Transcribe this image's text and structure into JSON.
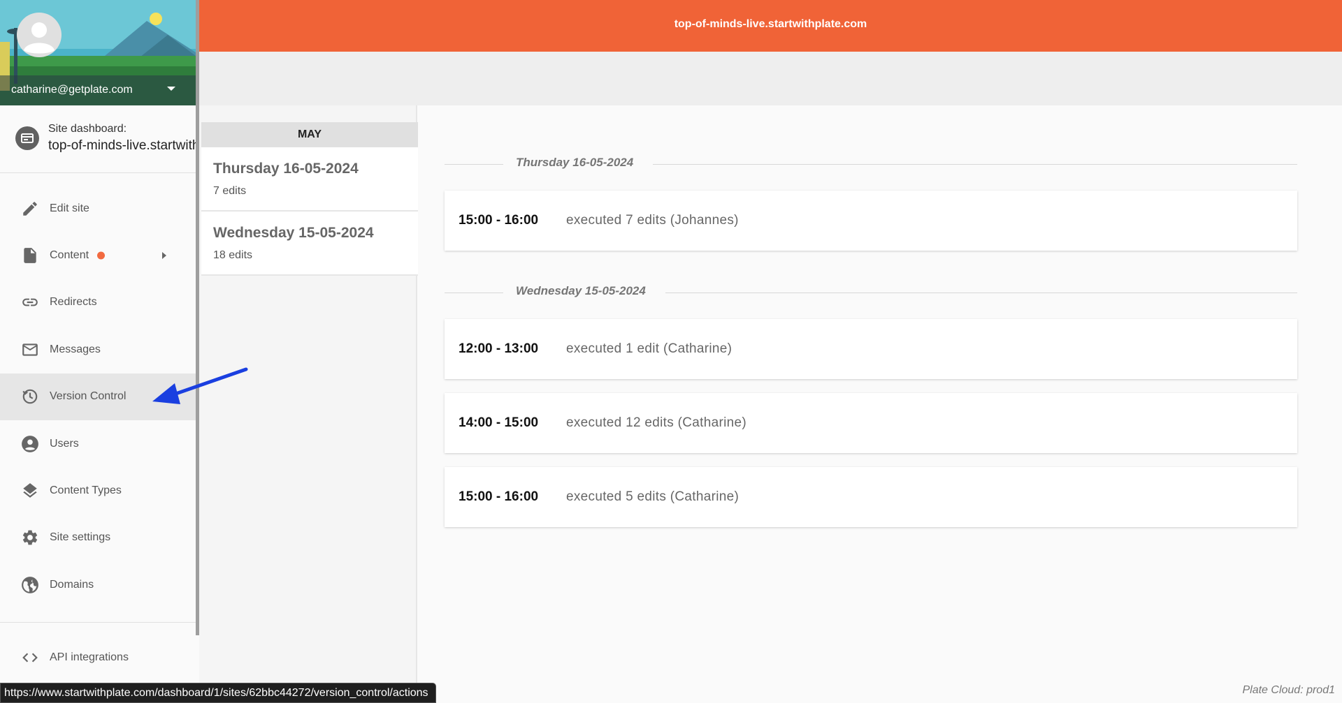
{
  "colors": {
    "accent": "#f06337",
    "annotation_arrow": "#1a3fe0"
  },
  "profile": {
    "email": "catharine@getplate.com"
  },
  "site_dashboard": {
    "label": "Site dashboard:",
    "name": "top-of-minds-live.startwithplate.com"
  },
  "sidebar": {
    "items": [
      {
        "label": "Edit site",
        "icon": "pencil-icon"
      },
      {
        "label": "Content",
        "icon": "document-icon",
        "has_dot": true,
        "has_submenu": true
      },
      {
        "label": "Redirects",
        "icon": "link-icon"
      },
      {
        "label": "Messages",
        "icon": "mail-icon"
      },
      {
        "label": "Version Control",
        "icon": "history-icon",
        "active": true
      },
      {
        "label": "Users",
        "icon": "account-icon"
      },
      {
        "label": "Content Types",
        "icon": "layers-icon"
      },
      {
        "label": "Site settings",
        "icon": "gear-icon"
      },
      {
        "label": "Domains",
        "icon": "globe-icon"
      }
    ],
    "api": {
      "label": "API integrations",
      "icon": "code-icon"
    }
  },
  "header": {
    "title": "top-of-minds-live.startwithplate.com"
  },
  "dates": {
    "month": "MAY",
    "days": [
      {
        "title": "Thursday 16-05-2024",
        "edits": "7 edits"
      },
      {
        "title": "Wednesday 15-05-2024",
        "edits": "18 edits"
      }
    ]
  },
  "timeline": [
    {
      "day": "Thursday 16-05-2024",
      "entries": [
        {
          "time": "15:00 - 16:00",
          "desc": "executed 7 edits (Johannes)"
        }
      ]
    },
    {
      "day": "Wednesday 15-05-2024",
      "entries": [
        {
          "time": "12:00 - 13:00",
          "desc": "executed 1 edit (Catharine)"
        },
        {
          "time": "14:00 - 15:00",
          "desc": "executed 12 edits (Catharine)"
        },
        {
          "time": "15:00 - 16:00",
          "desc": "executed 5 edits (Catharine)"
        }
      ]
    }
  ],
  "status_url": "https://www.startwithplate.com/dashboard/1/sites/62bbc44272/version_control/actions",
  "footer_note": "Plate Cloud: prod1"
}
